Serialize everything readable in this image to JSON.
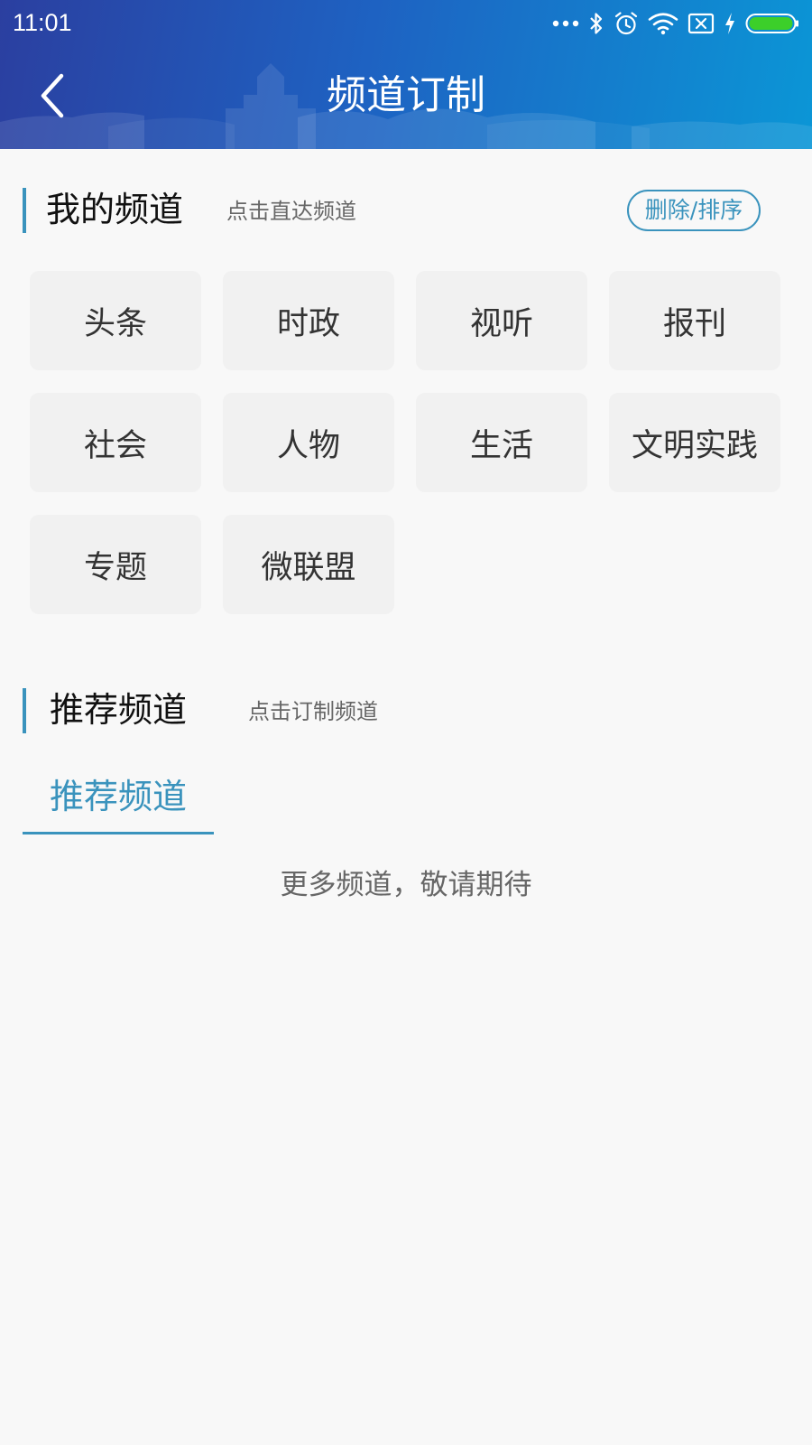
{
  "status_bar": {
    "time": "11:01",
    "icons": [
      "more-dots-icon",
      "bluetooth-icon",
      "alarm-icon",
      "wifi-icon",
      "sim-off-icon",
      "charging-icon",
      "battery-icon"
    ]
  },
  "nav": {
    "title": "频道订制",
    "back_icon": "chevron-left-icon"
  },
  "my_channels": {
    "title": "我的频道",
    "subtitle": "点击直达频道",
    "edit_label": "删除/排序",
    "items": [
      {
        "label": "头条"
      },
      {
        "label": "时政"
      },
      {
        "label": "视听"
      },
      {
        "label": "报刊"
      },
      {
        "label": "社会"
      },
      {
        "label": "人物"
      },
      {
        "label": "生活"
      },
      {
        "label": "文明实践"
      },
      {
        "label": "专题"
      },
      {
        "label": "微联盟"
      }
    ]
  },
  "recommended": {
    "title": "推荐频道",
    "subtitle": "点击订制频道",
    "tab_label": "推荐频道",
    "empty_message": "更多频道，敬请期待"
  },
  "colors": {
    "accent": "#3a93bd",
    "header_start": "#2b3fa0",
    "header_end": "#0b96d6",
    "tile_bg": "#f1f1f1",
    "page_bg": "#f8f8f8",
    "battery_green": "#3ccf2a"
  }
}
